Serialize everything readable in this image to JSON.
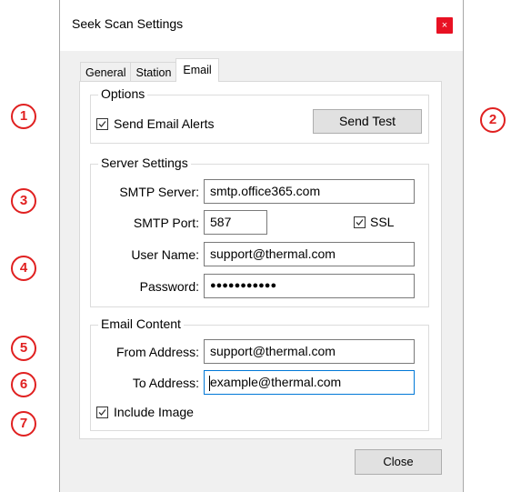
{
  "window": {
    "title": "Seek Scan Settings",
    "close_glyph": "×"
  },
  "tabs": [
    {
      "label": "General",
      "active": false
    },
    {
      "label": "Station",
      "active": false
    },
    {
      "label": "Email",
      "active": true
    }
  ],
  "options": {
    "title": "Options",
    "send_email_alerts_label": "Send Email Alerts",
    "send_email_alerts_checked": true,
    "send_test_label": "Send Test"
  },
  "server_settings": {
    "title": "Server Settings",
    "smtp_server_label": "SMTP Server:",
    "smtp_server_value": "smtp.office365.com",
    "smtp_port_label": "SMTP Port:",
    "smtp_port_value": "587",
    "ssl_label": "SSL",
    "ssl_checked": true,
    "user_name_label": "User Name:",
    "user_name_value": "support@thermal.com",
    "password_label": "Password:",
    "password_value": "●●●●●●●●●●●"
  },
  "email_content": {
    "title": "Email Content",
    "from_address_label": "From Address:",
    "from_address_value": "support@thermal.com",
    "to_address_label": "To Address:",
    "to_address_value": "example@thermal.com",
    "include_image_label": "Include Image",
    "include_image_checked": true
  },
  "footer": {
    "close_label": "Close"
  },
  "callouts": [
    "1",
    "2",
    "3",
    "4",
    "5",
    "6",
    "7"
  ],
  "colors": {
    "callout": "#e02020",
    "close_button_bg": "#e81123",
    "focus_border": "#0078d7"
  }
}
